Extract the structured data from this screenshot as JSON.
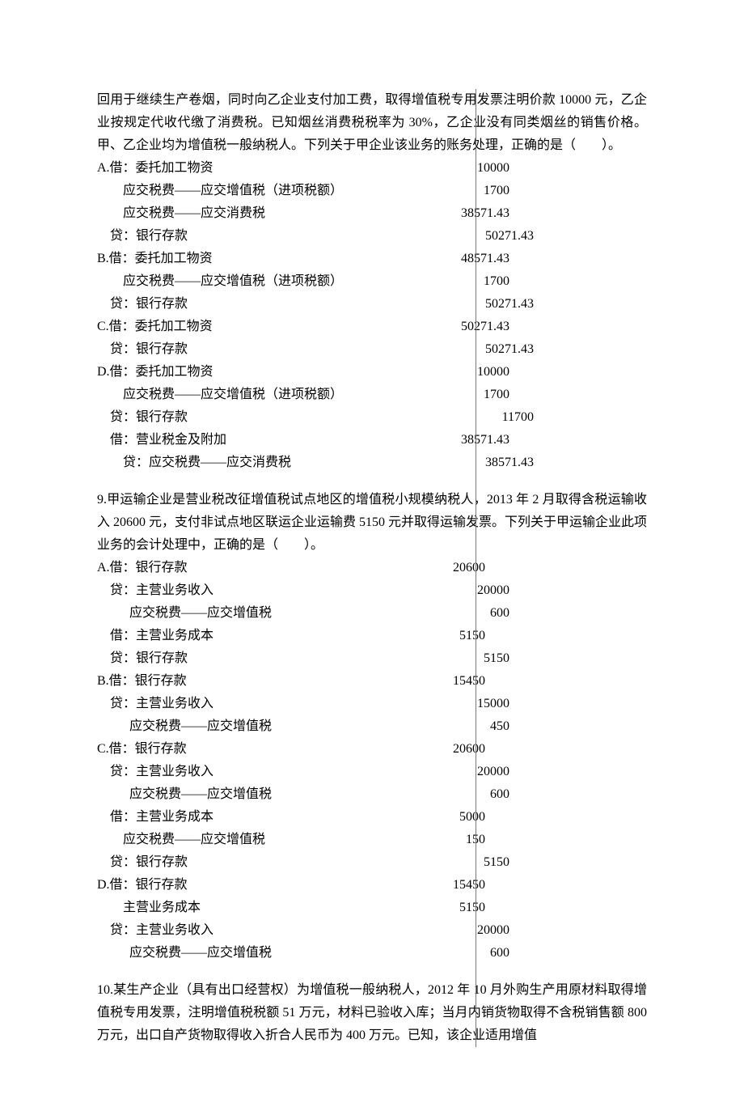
{
  "q8": {
    "intro": "回用于继续生产卷烟，同时向乙企业支付加工费，取得增值税专用发票注明价款 10000 元，乙企业按规定代收代缴了消费税。已知烟丝消费税税率为 30%，乙企业没有同类烟丝的销售价格。甲、乙企业均为增值税一般纳税人。下列关于甲企业该业务的账务处理，正确的是（　　）。",
    "A": {
      "l1": "A.借：委托加工物资",
      "a1": "10000",
      "l2": "        应交税费——应交增值税（进项税额）",
      "a2": "1700",
      "l3": "        应交税费——应交消费税",
      "a3": "38571.43",
      "l4": "    贷：银行存款",
      "a4": "50271.43"
    },
    "B": {
      "l1": "B.借：委托加工物资",
      "a1": "48571.43",
      "l2": "        应交税费——应交增值税（进项税额）",
      "a2": "1700",
      "l3": "    贷：银行存款",
      "a3": "50271.43"
    },
    "C": {
      "l1": "C.借：委托加工物资",
      "a1": "50271.43",
      "l2": "    贷：银行存款",
      "a2": "50271.43"
    },
    "D": {
      "l1": "D.借：委托加工物资",
      "a1": "10000",
      "l2": "        应交税费——应交增值税（进项税额）",
      "a2": "1700",
      "l3": "    贷：银行存款",
      "a3": "11700",
      "l4": "    借：营业税金及附加",
      "a4": "38571.43",
      "l5": "        贷：应交税费——应交消费税",
      "a5": "38571.43"
    }
  },
  "q9": {
    "intro": "9.甲运输企业是营业税改征增值税试点地区的增值税小规模纳税人，2013 年 2 月取得含税运输收入 20600 元，支付非试点地区联运企业运输费 5150 元并取得运输发票。下列关于甲运输企业此项业务的会计处理中，正确的是（　　）。",
    "A": {
      "l1": "A.借：银行存款",
      "a1": "20600",
      "l2": "    贷：主营业务收入",
      "a2": "20000",
      "l3": "          应交税费——应交增值税",
      "a3": "600",
      "l4": "    借：主营业务成本",
      "a4": "5150",
      "l5": "    贷：银行存款",
      "a5": "5150"
    },
    "B": {
      "l1": "B.借：银行存款",
      "a1": "15450",
      "l2": "    贷：主营业务收入",
      "a2": "15000",
      "l3": "          应交税费——应交增值税",
      "a3": "450"
    },
    "C": {
      "l1": "C.借：银行存款",
      "a1": "20600",
      "l2": "    贷：主营业务收入",
      "a2": "20000",
      "l3": "          应交税费——应交增值税",
      "a3": "600",
      "l4": "    借：主营业务成本",
      "a4": "5000",
      "l5": "        应交税费——应交增值税",
      "a5": "150",
      "l6": "    贷：银行存款",
      "a6": "5150"
    },
    "D": {
      "l1": "D.借：银行存款",
      "a1": "15450",
      "l2": "        主营业务成本",
      "a2": "5150",
      "l3": "    贷：主营业务收入",
      "a3": "20000",
      "l4": "          应交税费——应交增值税",
      "a4": "600"
    }
  },
  "q10": {
    "intro": "10.某生产企业（具有出口经营权）为增值税一般纳税人，2012 年 10 月外购生产用原材料取得增值税专用发票，注明增值税税额 51 万元，材料已验收入库；当月内销货物取得不含税销售额 800 万元，出口自产货物取得收入折合人民币为 400 万元。已知，该企业适用增值"
  },
  "widths": {
    "q8": {
      "label": "360px",
      "amt": "150px"
    },
    "q9": {
      "label": "360px",
      "amt": "120px"
    }
  }
}
